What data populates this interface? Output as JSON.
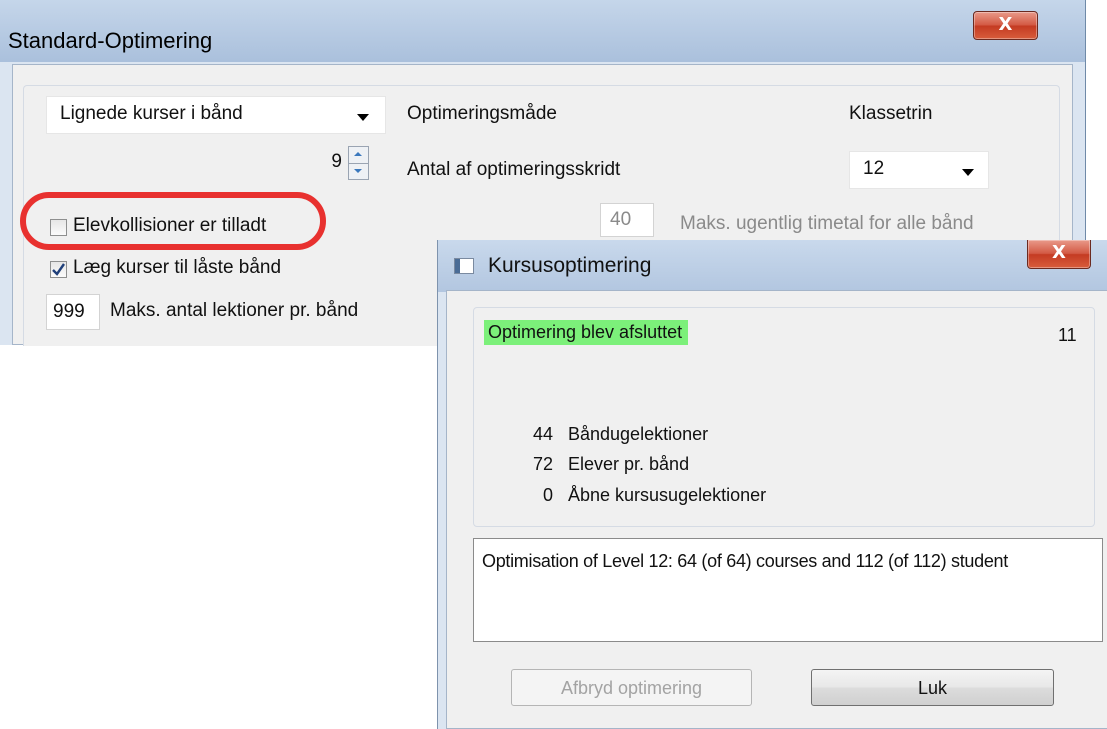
{
  "main_window": {
    "title": "Standard-Optimering",
    "close_label": "X",
    "combo_mode": {
      "value": "Lignede kurser i bånd"
    },
    "label_mode": "Optimeringsmåde",
    "label_grade": "Klassetrin",
    "steps_value": "9",
    "label_steps": "Antal af optimeringsskridt",
    "combo_grade": {
      "value": "12"
    },
    "hours_value": "40",
    "label_hours": "Maks. ugentlig timetal for alle bånd",
    "chk_collisions": {
      "label": "Elevkollisioner er tilladt",
      "checked": false
    },
    "chk_locked": {
      "label": "Læg kurser til låste bånd",
      "checked": true
    },
    "lessons_value": "999",
    "label_lessons": "Maks. antal lektioner pr. bånd"
  },
  "dialog": {
    "title": "Kursusoptimering",
    "close_label": "X",
    "status": "Optimering blev afsluttet",
    "step_count": "11",
    "stats": [
      {
        "value": "44",
        "label": "Båndugelektioner"
      },
      {
        "value": "72",
        "label": "Elever pr. bånd"
      },
      {
        "value": "0",
        "label": "Åbne kursusugelektioner"
      }
    ],
    "log_text": "Optimisation of Level 12: 64 (of 64) courses and 112 (of 112) student",
    "btn_abort": "Afbryd optimering",
    "btn_close": "Luk"
  },
  "colors": {
    "status_highlight": "#7cf07a",
    "annotation_ring": "#e8312f"
  }
}
